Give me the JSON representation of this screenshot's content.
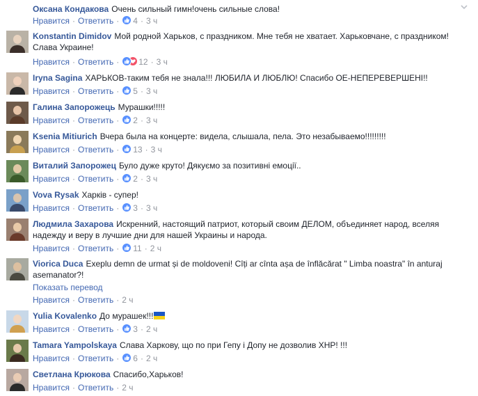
{
  "ui": {
    "like": "Нравится",
    "reply": "Ответить",
    "translate": "Показать перевод",
    "sep": "·"
  },
  "colors": {
    "name": "#365899",
    "link": "#4267b2",
    "meta": "#90949c",
    "like_icon": "#5890ff",
    "love_icon": "#f25268"
  },
  "comments": [
    {
      "author": "Оксана Кондакова",
      "text": "Очень сильный гимн!очень сильные слова!",
      "likes": "4",
      "time": "3 ч",
      "reaction": "like",
      "avatar": "none"
    },
    {
      "author": "Konstantin Dimidov",
      "text": "Мой родной Харьков, с праздником. Мне тебя не хватает. Харьковчане, с праздником! Слава Украине!",
      "likes": "12",
      "time": "3 ч",
      "reaction": "like-love",
      "avatar": "photo"
    },
    {
      "author": "Iryna Sagina",
      "text": "ХАРЬКОВ-таким тебя не знала!!! ЛЮБИЛА И ЛЮБЛЮ! Спасибо ОЕ-НЕПЕРЕВЕРШЕНІ!!",
      "likes": "5",
      "time": "3 ч",
      "reaction": "like",
      "avatar": "photo"
    },
    {
      "author": "Галина Запорожець",
      "text": "Мурашки!!!!!",
      "likes": "2",
      "time": "3 ч",
      "reaction": "like",
      "avatar": "photo"
    },
    {
      "author": "Ksenia Mitiurich",
      "text": "Вчера была на концерте: видела, слышала, пела. Это незабываемо!!!!!!!!!",
      "likes": "13",
      "time": "3 ч",
      "reaction": "like",
      "avatar": "photo"
    },
    {
      "author": "Виталий Запорожец",
      "text": "Було дуже круто! Дякуємо за позитивні емоції..",
      "likes": "2",
      "time": "3 ч",
      "reaction": "like",
      "avatar": "photo"
    },
    {
      "author": "Vova Rysak",
      "text": "Харків - супер!",
      "likes": "3",
      "time": "3 ч",
      "reaction": "like",
      "avatar": "photo"
    },
    {
      "author": "Людмила Захарова",
      "text": "Искренний, настоящий патриот, который своим ДЕЛОМ, объединяет народ, вселяя надежду и веру в лучшие дни для нашей Украины и народа.",
      "likes": "11",
      "time": "2 ч",
      "reaction": "like",
      "avatar": "photo"
    },
    {
      "author": "Viorica Duca",
      "text": "Exeplu demn de urmat și de moldoveni! Cîți ar cînta așa de înflăcărat \" Limba noastra\" în anturaj asemanator?!",
      "likes": "",
      "time": "2 ч",
      "reaction": "none",
      "avatar": "photo",
      "translate": true
    },
    {
      "author": "Yulia Kovalenko",
      "text": "До мурашек!!!",
      "likes": "3",
      "time": "2 ч",
      "reaction": "like",
      "avatar": "photo",
      "flag": true
    },
    {
      "author": "Tamara Yampolskaya",
      "text": "Слава Харкову, що по при Гепу і Допу не дозволив ХНР! !!!",
      "likes": "6",
      "time": "2 ч",
      "reaction": "like",
      "avatar": "photo"
    },
    {
      "author": "Светлана Крюкова",
      "text": "Спасибо,Харьков!",
      "likes": "",
      "time": "2 ч",
      "reaction": "none",
      "avatar": "photo"
    }
  ]
}
